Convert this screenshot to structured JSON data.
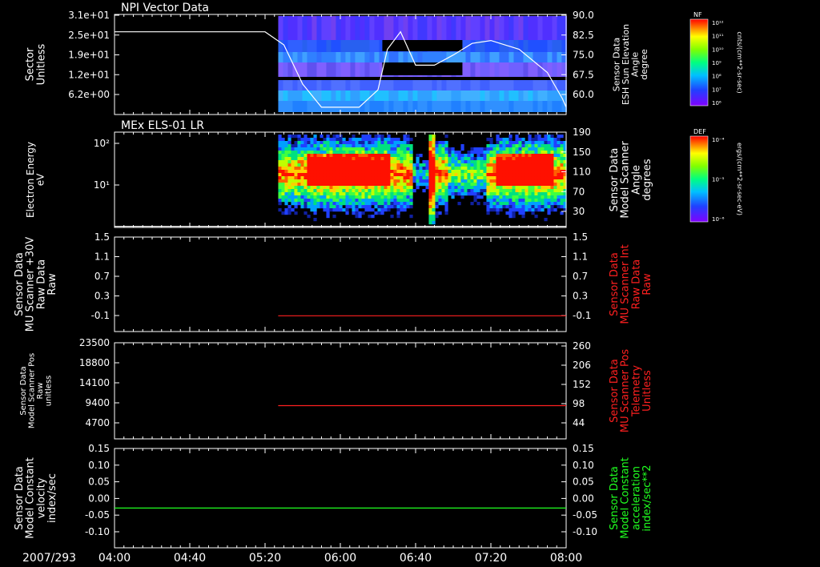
{
  "date_label": "2007/293",
  "time_ticks": [
    "04:00",
    "04:40",
    "05:20",
    "06:00",
    "06:40",
    "07:20",
    "08:00"
  ],
  "chart_data": [
    {
      "type": "heatmap",
      "title": "NPI Vector Data",
      "ylabel": "Sector\nUnitless",
      "yticks": [
        "3.1e+01",
        "2.5e+01",
        "1.9e+01",
        "1.2e+01",
        "6.2e+00"
      ],
      "ylabel_right": "Sensor Data\nESH Sun Elevation\nAngle\ndegree",
      "yticks_right": [
        "90.0",
        "82.5",
        "75.0",
        "67.5",
        "60.0"
      ],
      "ylim_right": [
        55.5,
        90.0
      ],
      "colorbar": {
        "label": "NF",
        "unit": "cnts/(cm**2-sr-sec)",
        "ticks": [
          "10¹²",
          "10¹¹",
          "10¹⁰",
          "10⁹",
          "10⁸",
          "10⁷",
          "10⁶"
        ]
      },
      "data_start": "05:27",
      "line": {
        "name": "ESH Sun Elevation Angle",
        "color": "#ffffff",
        "x": [
          "04:00",
          "05:20",
          "05:30",
          "05:40",
          "05:50",
          "06:00",
          "06:10",
          "06:20",
          "06:25",
          "06:32",
          "06:40",
          "06:50",
          "07:00",
          "07:10",
          "07:20",
          "07:35",
          "07:50",
          "07:58",
          "08:00"
        ],
        "y": [
          84.0,
          84.0,
          79.5,
          66.0,
          58.0,
          58.0,
          58.0,
          64.0,
          78.0,
          84.0,
          72.5,
          72.5,
          76.0,
          80.0,
          81.0,
          78.0,
          70.0,
          61.0,
          58.0
        ]
      }
    },
    {
      "type": "heatmap",
      "title": "MEx ELS-01 LR",
      "ylabel": "Electron Energy\neV",
      "yticks": [
        "10²",
        "10¹"
      ],
      "ylabel_right": "Sensor Data\nModel Scanner\nAngle\ndegrees",
      "yticks_right": [
        "190",
        "150",
        "110",
        "70",
        "30"
      ],
      "ylim_right": [
        0,
        190
      ],
      "colorbar": {
        "label": "DEF",
        "unit": "ergs/(cm**2-sr-sec-eV)",
        "ticks": [
          "10⁻⁴",
          "10⁻⁵",
          "10⁻⁶"
        ]
      },
      "data_start": "05:27",
      "line": {
        "name": "Model Scanner Angle",
        "color": "#ffffff",
        "x": [
          "04:00",
          "08:00"
        ],
        "y": [
          2,
          2
        ]
      }
    },
    {
      "type": "line",
      "ylabel": "Sensor Data\nMU Scanner +30V\nRaw Data\nRaw",
      "yticks": [
        "1.5",
        "1.1",
        "0.7",
        "0.3",
        "-0.1"
      ],
      "ylim": [
        -0.3,
        1.5
      ],
      "ylabel_right": "Sensor Data\nMU Scanner Int\nRaw Data\nRaw",
      "ylabel_right_color": "#ff2020",
      "yticks_right": [
        "1.5",
        "1.1",
        "0.7",
        "0.3",
        "-0.1"
      ],
      "ylim_right": [
        -0.3,
        1.5
      ],
      "series": [
        {
          "name": "MU Scanner Int Raw Data",
          "color": "#ff2020",
          "x": [
            "05:27",
            "08:00"
          ],
          "y": [
            0.0,
            0.0
          ]
        }
      ]
    },
    {
      "type": "line",
      "ylabel": "Sensor Data\nModel Scanner Pos\nRaw\nunitless",
      "yticks": [
        "23500",
        "18800",
        "14100",
        "9400",
        "4700"
      ],
      "ylim": [
        0,
        23500
      ],
      "ylabel_right": "Sensor Data\nMU Scanner Pos\nTelemetry\nUnitless",
      "ylabel_right_color": "#ff2020",
      "yticks_right": [
        "260",
        "206",
        "152",
        "98",
        "44"
      ],
      "ylim_right": [
        0,
        260
      ],
      "series": [
        {
          "name": "MU Scanner Pos Telemetry",
          "color": "#ff2020",
          "x": [
            "05:27",
            "08:00"
          ],
          "y": [
            90,
            90
          ]
        }
      ]
    },
    {
      "type": "line",
      "ylabel": "Sensor Data\nModel Constant\nvelocity\nindex/sec",
      "yticks": [
        "0.15",
        "0.10",
        "0.05",
        "0.00",
        "-0.05",
        "-0.10"
      ],
      "ylim": [
        -0.1,
        0.15
      ],
      "ylabel_right": "Sensor Data\nModel Constant\nacceleration\nindex/sec**2",
      "ylabel_right_color": "#20ff20",
      "yticks_right": [
        "0.15",
        "0.10",
        "0.05",
        "0.00",
        "-0.05",
        "-0.10"
      ],
      "ylim_right": [
        -0.1,
        0.15
      ],
      "series": [
        {
          "name": "Model Constant acceleration",
          "color": "#20ff20",
          "x": [
            "04:00",
            "08:00"
          ],
          "y": [
            0.0,
            0.0
          ]
        }
      ]
    }
  ]
}
